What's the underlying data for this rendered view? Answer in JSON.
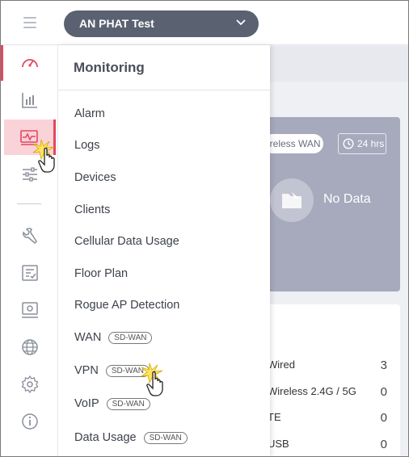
{
  "header": {
    "org_name": "AN PHAT Test"
  },
  "sidebar": {
    "items": [
      {
        "icon": "dashboard-icon"
      },
      {
        "icon": "reports-icon"
      },
      {
        "icon": "monitoring-icon",
        "active": true
      },
      {
        "icon": "configure-icon"
      },
      {
        "icon": "tools-icon"
      },
      {
        "icon": "checklist-icon"
      },
      {
        "icon": "device-settings-icon"
      },
      {
        "icon": "globe-icon"
      },
      {
        "icon": "settings-icon"
      },
      {
        "icon": "info-icon"
      }
    ]
  },
  "flyout": {
    "title": "Monitoring",
    "items": [
      {
        "label": "Alarm"
      },
      {
        "label": "Logs"
      },
      {
        "label": "Devices"
      },
      {
        "label": "Clients"
      },
      {
        "label": "Cellular Data Usage"
      },
      {
        "label": "Floor Plan"
      },
      {
        "label": "Rogue AP Detection"
      },
      {
        "label": "WAN",
        "tag": "SD-WAN"
      },
      {
        "label": "VPN",
        "tag": "SD-WAN"
      },
      {
        "label": "VoIP",
        "tag": "SD-WAN"
      },
      {
        "label": "Data Usage",
        "tag": "SD-WAN"
      }
    ]
  },
  "main": {
    "wan_card": {
      "filter_label": "ireless WAN",
      "time_range": "24 hrs",
      "empty_text": "No Data"
    },
    "clients_card": {
      "rows": [
        {
          "label": "Wired",
          "value": "3"
        },
        {
          "label": "Wireless 2.4G / 5G",
          "value": "0"
        },
        {
          "label": "TE",
          "value": "0"
        },
        {
          "label": "USB",
          "value": "0"
        }
      ]
    }
  },
  "colors": {
    "accent": "#e3475f",
    "active_bg": "#f9d3d8",
    "org_pill": "#5a6170",
    "card_dark": "#a7a9bd"
  }
}
